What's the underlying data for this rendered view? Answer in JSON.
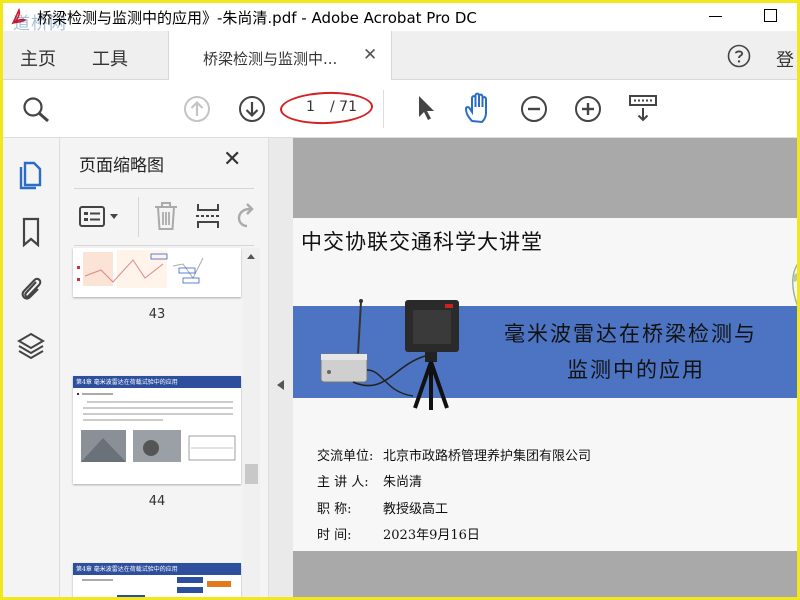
{
  "window": {
    "title": "桥梁检测与监测中的应用》-朱尚清.pdf - Adobe Acrobat Pro DC",
    "watermark": "道桥网"
  },
  "tabs": {
    "home": "主页",
    "tools": "工具",
    "doc": "桥梁检测与监测中...",
    "login": "登"
  },
  "toolbar": {
    "page_current": "1",
    "page_total": "/ 71"
  },
  "thumb_panel": {
    "title": "页面缩略图",
    "pages": [
      {
        "number": "43"
      },
      {
        "number": "44",
        "header": "第4章  毫米波雷达在荷载试验中的应用"
      },
      {
        "header": "第4章  毫米波雷达在荷载试验中的应用"
      }
    ]
  },
  "slide": {
    "header": "中交协联交通科学大讲堂",
    "title_line1": "毫米波雷达在桥梁检测与",
    "title_line2": "监测中的应用",
    "rows": [
      {
        "label": "交流单位:",
        "value": "北京市政路桥管理养护集团有限公司"
      },
      {
        "label": "主 讲 人:",
        "value": "朱尚清"
      },
      {
        "label": "职    称:",
        "value": "教授级高工"
      },
      {
        "label": "时    间:",
        "value": "2023年9月16日"
      }
    ]
  },
  "colors": {
    "accent_blue": "#2b6cc4",
    "band_blue": "#4d74c2",
    "highlight_red": "#d42020",
    "frame_yellow": "#f2e61c"
  }
}
